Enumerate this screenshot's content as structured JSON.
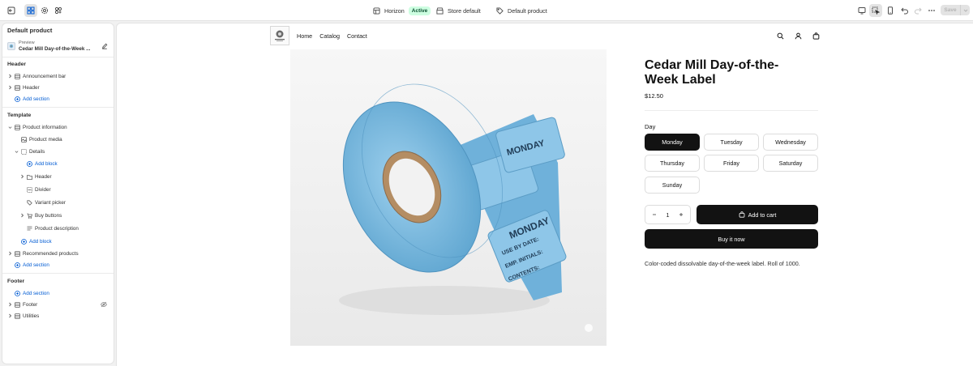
{
  "topbar": {
    "theme_name": "Horizon",
    "theme_status": "Active",
    "store": "Store default",
    "template": "Default product",
    "save_label": "Save"
  },
  "sidebar": {
    "title": "Default product",
    "preview_label": "Preview",
    "preview_name": "Cedar Mill Day-of-the-Week ...",
    "header_heading": "Header",
    "header_items": [
      {
        "label": "Announcement bar"
      },
      {
        "label": "Header"
      }
    ],
    "add_section": "Add section",
    "template_heading": "Template",
    "template_items": {
      "product_information": "Product information",
      "product_media": "Product media",
      "details": "Details",
      "add_block": "Add block",
      "header": "Header",
      "divider": "Divider",
      "variant_picker": "Variant picker",
      "buy_buttons": "Buy buttons",
      "product_description": "Product description",
      "recommended_products": "Recommended products"
    },
    "footer_heading": "Footer",
    "footer_items": [
      {
        "label": "Footer"
      },
      {
        "label": "Utilities"
      }
    ]
  },
  "store": {
    "nav": [
      "Home",
      "Catalog",
      "Contact"
    ],
    "product": {
      "title": "Cedar Mill Day-of-the-Week Label",
      "price": "$12.50",
      "option_label": "Day",
      "days": [
        "Monday",
        "Tuesday",
        "Wednesday",
        "Thursday",
        "Friday",
        "Saturday",
        "Sunday"
      ],
      "selected_day": "Monday",
      "quantity": "1",
      "add_to_cart": "Add to cart",
      "buy_now": "Buy it now",
      "description": "Color-coded dissolvable day-of-the-week label. Roll of 1000.",
      "label_lines": [
        "MONDAY",
        "USE BY DATE:",
        "EMP. INITIALS:",
        "CONTENTS:"
      ]
    }
  },
  "colors": {
    "accent": "#005bd3",
    "active_badge_bg": "#cdfee1",
    "button_dark": "#121212",
    "label_blue": "#79b8de"
  }
}
